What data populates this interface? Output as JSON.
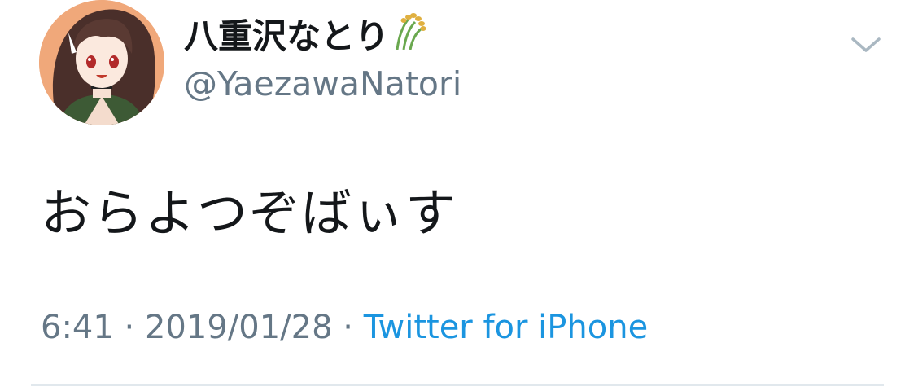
{
  "tweet": {
    "display_name": "八重沢なとり",
    "name_emoji_icon": "rice-ear-icon",
    "handle": "@YaezawaNatori",
    "text": "おらよつぞばぃす",
    "time": "6:41",
    "separator": " · ",
    "date": "2019/01/28",
    "source": "Twitter for iPhone"
  },
  "colors": {
    "name": "#14171a",
    "secondary": "#657786",
    "link": "#1b95e0",
    "divider": "#e1e8ed"
  }
}
